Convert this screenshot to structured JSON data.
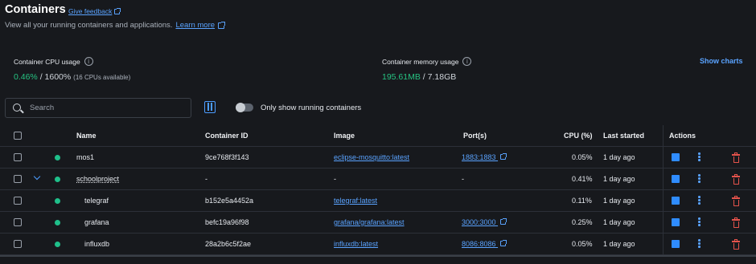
{
  "header": {
    "title": "Containers",
    "feedback_link": "Give feedback",
    "subtitle": "View all your running containers and applications.",
    "learn_more": "Learn more"
  },
  "stats": {
    "cpu_label": "Container CPU usage",
    "cpu_used": "0.46%",
    "cpu_total": " / 1600%",
    "cpu_note": "(16 CPUs available)",
    "mem_label": "Container memory usage",
    "mem_used": "195.61MB",
    "mem_total": " / 7.18GB",
    "show_charts": "Show charts"
  },
  "toolbar": {
    "search_placeholder": "Search",
    "toggle_label": "Only show running containers",
    "toggle_on": false
  },
  "table": {
    "columns": [
      "Name",
      "Container ID",
      "Image",
      "Port(s)",
      "CPU (%)",
      "Last started",
      "Actions"
    ],
    "rows": [
      {
        "name": "mos1",
        "id": "9ce768f3f143",
        "image": "eclipse-mosquitto:latest",
        "ports": "1883:1883",
        "cpu": "0.05%",
        "started": "1 day ago",
        "status": "running",
        "group": false,
        "child": false
      },
      {
        "name": "schoolproject",
        "id": "-",
        "image": "-",
        "ports": "-",
        "cpu": "0.41%",
        "started": "1 day ago",
        "status": "running",
        "group": true,
        "child": false
      },
      {
        "name": "telegraf",
        "id": "b152e5a4452a",
        "image": "telegraf:latest",
        "ports": "",
        "cpu": "0.11%",
        "started": "1 day ago",
        "status": "running",
        "group": false,
        "child": true
      },
      {
        "name": "grafana",
        "id": "befc19a96f98",
        "image": "grafana/grafana:latest",
        "ports": "3000:3000",
        "cpu": "0.25%",
        "started": "1 day ago",
        "status": "running",
        "group": false,
        "child": true
      },
      {
        "name": "influxdb",
        "id": "28a2b6c5f2ae",
        "image": "influxdb:latest",
        "ports": "8086:8086",
        "cpu": "0.05%",
        "started": "1 day ago",
        "status": "running",
        "group": false,
        "child": true
      }
    ]
  },
  "colors": {
    "background": "#17191d",
    "accent": "#2f8cff",
    "running": "#1fbf8a",
    "danger": "#e5534b"
  }
}
